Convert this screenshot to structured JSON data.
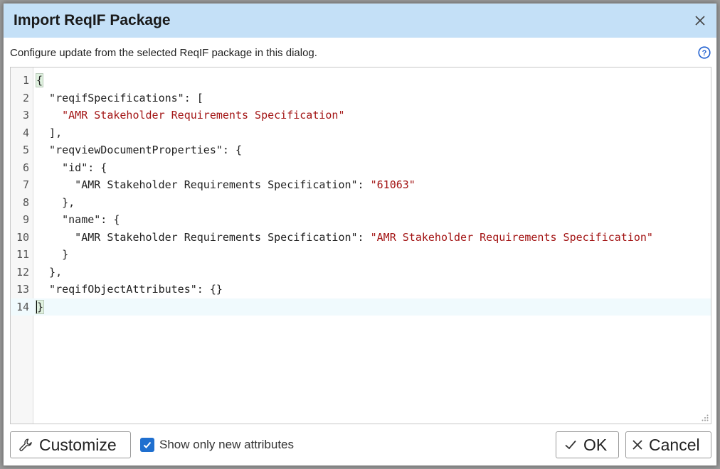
{
  "dialog": {
    "title": "Import ReqIF Package",
    "description": "Configure update from the selected ReqIF package in this dialog."
  },
  "editor": {
    "lines": [
      {
        "no": "1",
        "parts": [
          {
            "t": "{",
            "c": "brace"
          }
        ]
      },
      {
        "no": "2",
        "parts": [
          {
            "t": "  \"reqifSpecifications\": [",
            "c": "plain"
          }
        ]
      },
      {
        "no": "3",
        "parts": [
          {
            "t": "    ",
            "c": "plain"
          },
          {
            "t": "\"AMR Stakeholder Requirements Specification\"",
            "c": "str"
          }
        ]
      },
      {
        "no": "4",
        "parts": [
          {
            "t": "  ],",
            "c": "plain"
          }
        ]
      },
      {
        "no": "5",
        "parts": [
          {
            "t": "  \"reqviewDocumentProperties\": {",
            "c": "plain"
          }
        ]
      },
      {
        "no": "6",
        "parts": [
          {
            "t": "    \"id\": {",
            "c": "plain"
          }
        ]
      },
      {
        "no": "7",
        "parts": [
          {
            "t": "      \"AMR Stakeholder Requirements Specification\": ",
            "c": "plain"
          },
          {
            "t": "\"61063\"",
            "c": "str"
          }
        ]
      },
      {
        "no": "8",
        "parts": [
          {
            "t": "    },",
            "c": "plain"
          }
        ]
      },
      {
        "no": "9",
        "parts": [
          {
            "t": "    \"name\": {",
            "c": "plain"
          }
        ]
      },
      {
        "no": "10",
        "parts": [
          {
            "t": "      \"AMR Stakeholder Requirements Specification\": ",
            "c": "plain"
          },
          {
            "t": "\"AMR Stakeholder Requirements Specification\"",
            "c": "str"
          }
        ]
      },
      {
        "no": "11",
        "parts": [
          {
            "t": "    }",
            "c": "plain"
          }
        ]
      },
      {
        "no": "12",
        "parts": [
          {
            "t": "  },",
            "c": "plain"
          }
        ]
      },
      {
        "no": "13",
        "parts": [
          {
            "t": "  \"reqifObjectAttributes\": {}",
            "c": "plain"
          }
        ]
      },
      {
        "no": "14",
        "parts": [
          {
            "t": "}",
            "c": "brace"
          }
        ]
      }
    ],
    "active_line": 14
  },
  "footer": {
    "customize_label": "Customize",
    "show_new_label": "Show only new attributes",
    "show_new_checked": true,
    "ok_label": "OK",
    "cancel_label": "Cancel"
  },
  "icons": {
    "close": "close-icon",
    "help": "help-icon",
    "customize": "wrench-icon",
    "ok": "checkmark-icon",
    "cancel": "x-icon"
  },
  "colors": {
    "titlebar": "#c4e0f7",
    "string": "#a31515",
    "accent": "#1f6fcf"
  }
}
